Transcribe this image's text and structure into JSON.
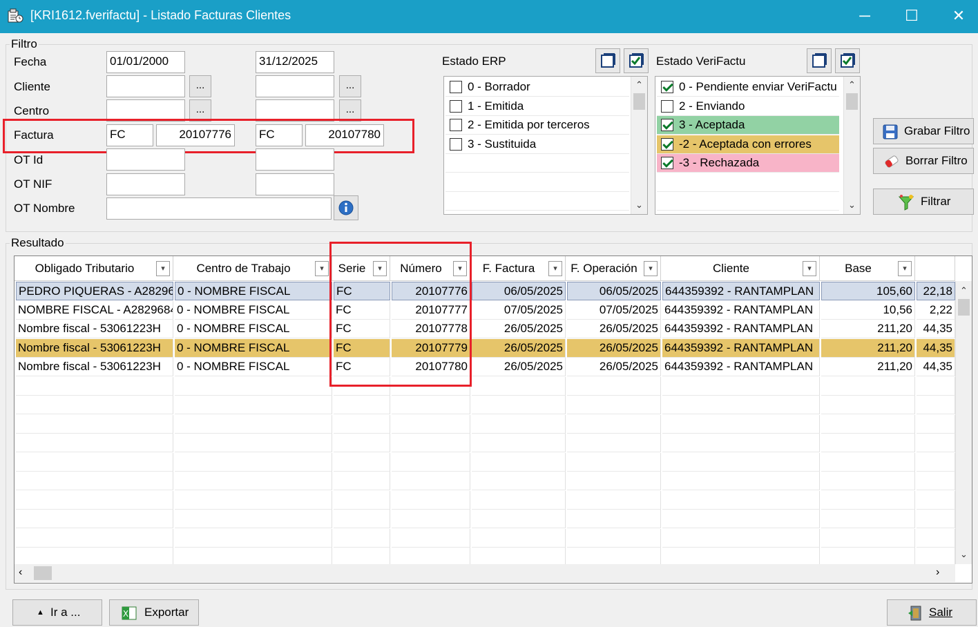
{
  "window": {
    "title": "[KRI1612.fverifactu] - Listado Facturas Clientes"
  },
  "filtro": {
    "legend": "Filtro",
    "fecha_label": "Fecha",
    "fecha_desde": "01/01/2000",
    "fecha_hasta": "31/12/2025",
    "cliente_label": "Cliente",
    "centro_label": "Centro",
    "factura_label": "Factura",
    "factura_serie_desde": "FC",
    "factura_num_desde": "20107776",
    "factura_serie_hasta": "FC",
    "factura_num_hasta": "20107780",
    "ot_id_label": "OT Id",
    "ot_nif_label": "OT NIF",
    "ot_nombre_label": "OT Nombre",
    "dots": "..."
  },
  "estado_erp": {
    "title": "Estado ERP",
    "items": [
      {
        "label": "0 - Borrador",
        "checked": false
      },
      {
        "label": "1 - Emitida",
        "checked": false
      },
      {
        "label": "2 - Emitida por terceros",
        "checked": false
      },
      {
        "label": "3 - Sustituida",
        "checked": false
      }
    ]
  },
  "estado_verifactu": {
    "title": "Estado VeriFactu",
    "items": [
      {
        "label": "0 - Pendiente enviar VeriFactu",
        "checked": true,
        "color": "#ffffff"
      },
      {
        "label": "2 - Enviando",
        "checked": false,
        "color": "#ffffff"
      },
      {
        "label": "3 - Aceptada",
        "checked": true,
        "color": "#92d2a4"
      },
      {
        "label": "-2 - Aceptada con errores",
        "checked": true,
        "color": "#e6c56a"
      },
      {
        "label": "-3 - Rechazada",
        "checked": true,
        "color": "#f8b4c8"
      }
    ]
  },
  "actions": {
    "grabar_filtro": "Grabar Filtro",
    "borrar_filtro": "Borrar Filtro",
    "filtrar": "Filtrar"
  },
  "resultado": {
    "legend": "Resultado",
    "columns": [
      "Obligado Tributario",
      "Centro de Trabajo",
      "Serie",
      "Número",
      "F. Factura",
      "F. Operación",
      "Cliente",
      "Base",
      ""
    ],
    "rows": [
      [
        "PEDRO PIQUERAS - A28296",
        "0 - NOMBRE FISCAL",
        "FC",
        "20107776",
        "06/05/2025",
        "06/05/2025",
        "644359392 - RANTAMPLAN",
        "105,60",
        "22,18"
      ],
      [
        "NOMBRE FISCAL - A2829684(",
        "0 - NOMBRE FISCAL",
        "FC",
        "20107777",
        "07/05/2025",
        "07/05/2025",
        "644359392 - RANTAMPLAN",
        "10,56",
        "2,22"
      ],
      [
        "Nombre fiscal - 53061223H",
        "0 - NOMBRE FISCAL",
        "FC",
        "20107778",
        "26/05/2025",
        "26/05/2025",
        "644359392 - RANTAMPLAN",
        "211,20",
        "44,35"
      ],
      [
        "Nombre fiscal - 53061223H",
        "0 - NOMBRE FISCAL",
        "FC",
        "20107779",
        "26/05/2025",
        "26/05/2025",
        "644359392 - RANTAMPLAN",
        "211,20",
        "44,35"
      ],
      [
        "Nombre fiscal - 53061223H",
        "0 - NOMBRE FISCAL",
        "FC",
        "20107780",
        "26/05/2025",
        "26/05/2025",
        "644359392 - RANTAMPLAN",
        "211,20",
        "44,35"
      ]
    ],
    "row_states": [
      "selected",
      "normal",
      "normal",
      "highlight",
      "normal"
    ],
    "highlight_color": "#e6c56a"
  },
  "footer": {
    "ir_a": "Ir a ...",
    "exportar": "Exportar",
    "salir": "Salir"
  }
}
